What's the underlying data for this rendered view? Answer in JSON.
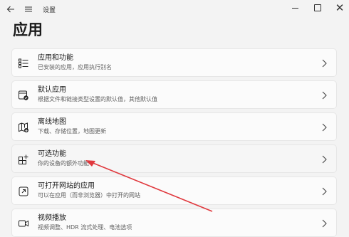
{
  "window": {
    "title": "设置",
    "back_icon": "arrow-left-icon",
    "menu_icon": "hamburger-menu-icon",
    "controls": [
      "minimize-icon",
      "maximize-icon",
      "close-icon"
    ]
  },
  "page": {
    "title": "应用"
  },
  "items": [
    {
      "title": "应用和功能",
      "subtitle": "已安装的应用，应用执行别名",
      "icon": "apps-list-icon"
    },
    {
      "title": "默认应用",
      "subtitle": "根据文件和链接类型设置的默认值，其他默认值",
      "icon": "default-apps-icon"
    },
    {
      "title": "离线地图",
      "subtitle": "下载、存储位置，地图更新",
      "icon": "offline-map-icon"
    },
    {
      "title": "可选功能",
      "subtitle": "你的设备的额外功能",
      "icon": "optional-features-icon"
    },
    {
      "title": "可打开网站的应用",
      "subtitle": "可以在应用（而非浏览器）中打开的网站",
      "icon": "open-in-app-icon"
    },
    {
      "title": "视频播放",
      "subtitle": "视频调整、HDR 流式处理、电池选项",
      "icon": "video-playback-icon"
    }
  ],
  "annotation": {
    "type": "arrow",
    "color": "#e0393e"
  },
  "colors": {
    "background": "#f3f3f3",
    "card": "#fbfbfb",
    "accent_arrow": "#e0393e"
  }
}
